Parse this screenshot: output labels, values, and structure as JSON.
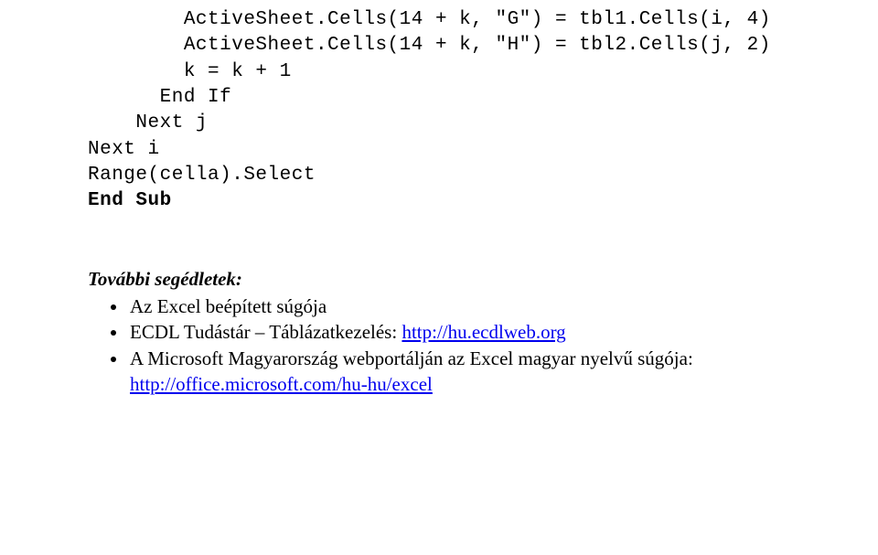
{
  "code": {
    "l1": "        ActiveSheet.Cells(14 + k, \"G\") = tbl1.Cells(i, 4)",
    "l2": "        ActiveSheet.Cells(14 + k, \"H\") = tbl2.Cells(j, 2)",
    "l3": "        k = k + 1",
    "l4": "      End If",
    "l5": "    Next j",
    "l6": "Next i",
    "blank1": "",
    "l7": "Range(cella).Select",
    "blank2": "",
    "l8": "End Sub"
  },
  "heading": "További segédletek:",
  "bullets": [
    {
      "text": "Az Excel beépített súgója"
    },
    {
      "prefix": "ECDL Tudástár – Táblázatkezelés: ",
      "link": "http://hu.ecdlweb.org"
    },
    {
      "prefix": "A Microsoft Magyarország webportálján az Excel magyar nyelvű súgója: ",
      "link": "http://office.microsoft.com/hu-hu/excel"
    }
  ]
}
